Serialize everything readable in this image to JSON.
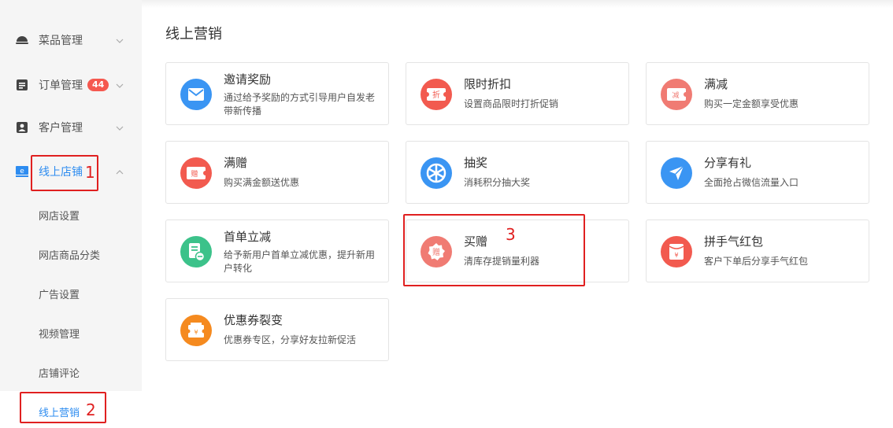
{
  "sidebar": {
    "menu": [
      {
        "label": "菜品管理",
        "icon": "dish-icon"
      },
      {
        "label": "订单管理",
        "icon": "order-icon",
        "badge": "44"
      },
      {
        "label": "客户管理",
        "icon": "customer-icon"
      },
      {
        "label": "线上店铺",
        "icon": "store-icon"
      }
    ],
    "sub_items": [
      "网店设置",
      "网店商品分类",
      "广告设置",
      "视频管理",
      "店铺评论",
      "线上营销"
    ]
  },
  "annotations": [
    "1",
    "2",
    "3"
  ],
  "page_title": "线上营销",
  "cards": [
    {
      "title": "邀请奖励",
      "desc": "通过给予奖励的方式引导用户自发老带新传播",
      "icon": "envelope-icon",
      "color": "#3a95f3"
    },
    {
      "title": "限时折扣",
      "desc": "设置商品限时打折促销",
      "icon": "discount-ticket-icon",
      "glyph": "折",
      "color": "#f25a4f"
    },
    {
      "title": "满减",
      "desc": "购买一定金额享受优惠",
      "icon": "reduction-ticket-icon",
      "glyph": "减",
      "color": "#f07b73"
    },
    {
      "title": "满赠",
      "desc": "购买满金额送优惠",
      "icon": "gift-ticket-icon",
      "glyph": "赠",
      "color": "#f25a4f"
    },
    {
      "title": "抽奖",
      "desc": "消耗积分抽大奖",
      "icon": "wheel-icon",
      "color": "#3a95f3"
    },
    {
      "title": "分享有礼",
      "desc": "全面抢占微信流量入口",
      "icon": "paper-plane-icon",
      "color": "#3a95f3"
    },
    {
      "title": "首单立减",
      "desc": "给予新用户首单立减优惠，提升新用户转化",
      "icon": "first-order-icon",
      "color": "#3cc28a"
    },
    {
      "title": "买赠",
      "desc": "清库存提销量利器",
      "icon": "buy-gift-icon",
      "glyph": "赠",
      "color": "#f07b73"
    },
    {
      "title": "拼手气红包",
      "desc": "客户下单后分享手气红包",
      "icon": "red-packet-icon",
      "glyph": "¥",
      "color": "#f25a4f"
    },
    {
      "title": "优惠券裂变",
      "desc": "优惠券专区，分享好友拉新促活",
      "icon": "coupon-icon",
      "glyph": "¥",
      "color": "#f58a1f"
    }
  ],
  "colors": {
    "accent": "#2d8cf0",
    "annotation_red": "#e02020",
    "badge": "#f5584f"
  }
}
